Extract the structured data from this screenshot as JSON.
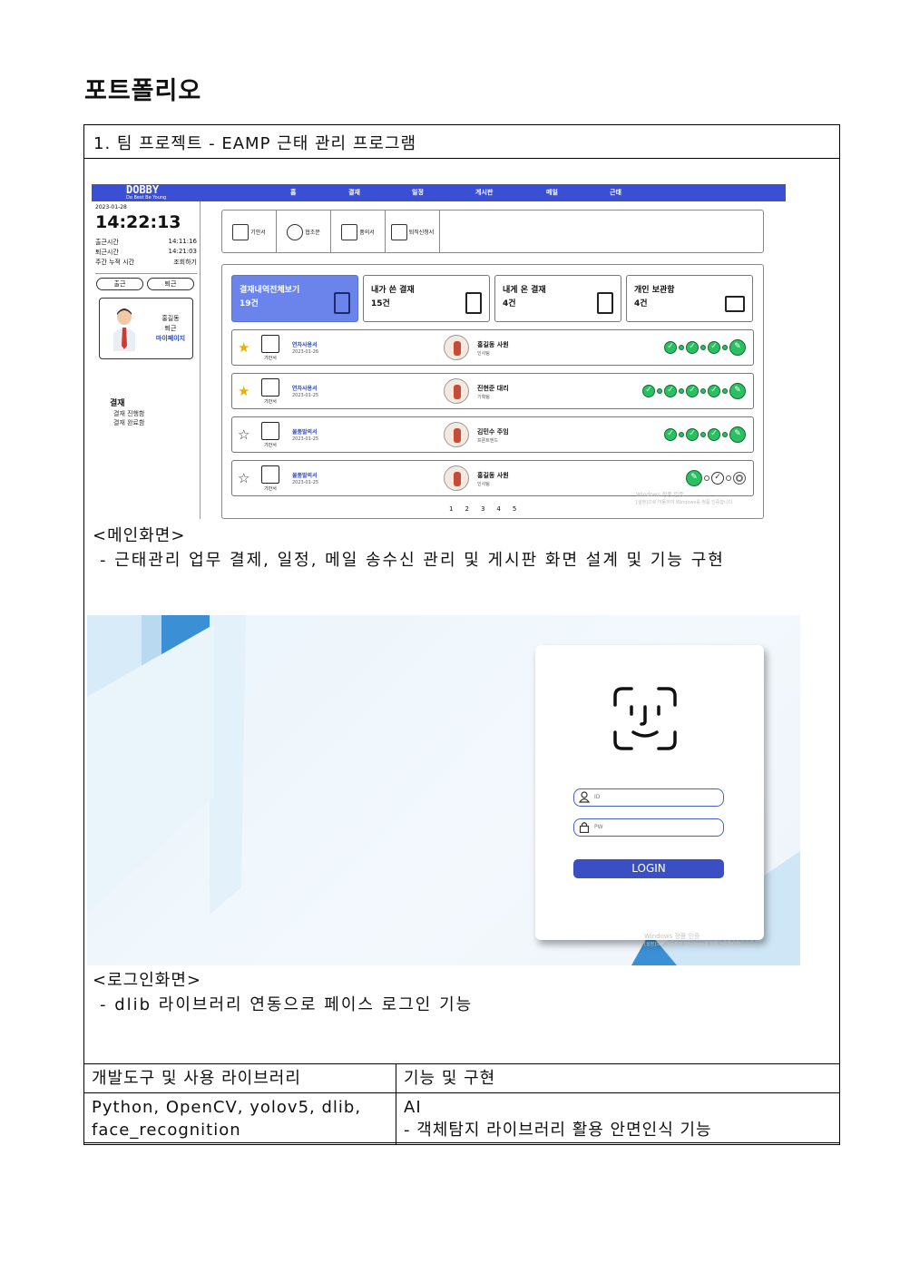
{
  "page_title": "포트폴리오",
  "section": {
    "heading": "1. 팀 프로젝트  - EAMP 근태 관리 프로그램"
  },
  "main_screen": {
    "logo": "DOBBY",
    "logo_sub": "Do Best Be Young",
    "nav": [
      "홈",
      "결재",
      "일정",
      "게시판",
      "메일",
      "근태"
    ],
    "date": "2023-01-28",
    "clock": "14:22:13",
    "times": [
      {
        "label": "출근시간",
        "value": "14:11:16"
      },
      {
        "label": "퇴근시간",
        "value": "14:21:03"
      },
      {
        "label": "주간 누적 시간",
        "value": "조회하기"
      }
    ],
    "btn_in": "출근",
    "btn_out": "퇴근",
    "profile": {
      "name": "홍길동",
      "status": "퇴근",
      "mypage": "마이페이지"
    },
    "menu": {
      "title": "결재",
      "items": [
        "결재 진행함",
        "결재 완료함"
      ]
    },
    "quick": [
      "기안서",
      "협조문",
      "품의서",
      "퇴직신청서"
    ],
    "tabs": [
      {
        "label": "결재내역전체보기",
        "count": "19건"
      },
      {
        "label": "내가 쓴 결재",
        "count": "15건"
      },
      {
        "label": "내게 온 결재",
        "count": "4건"
      },
      {
        "label": "개인 보관함",
        "count": "4건"
      }
    ],
    "docs": [
      {
        "star": "★",
        "icon_caption": "기안서",
        "title": "연차사용서",
        "date": "2023-01-26",
        "person": "홍길동 사원",
        "dept": "인사팀"
      },
      {
        "star": "★",
        "icon_caption": "기안서",
        "title": "연차사용서",
        "date": "2023-01-25",
        "person": "진현준 대리",
        "dept": "기획팀"
      },
      {
        "star": "☆",
        "icon_caption": "기안서",
        "title": "물품발의서",
        "date": "2023-01-25",
        "person": "김민수 주임",
        "dept": "프론트엔드"
      },
      {
        "star": "☆",
        "icon_caption": "기안서",
        "title": "물품발의서",
        "date": "2023-01-25",
        "person": "홍길동 사원",
        "dept": "인사팀"
      }
    ],
    "pages": [
      "1",
      "2",
      "3",
      "4",
      "5"
    ],
    "watermark_1": "Windows 정품 인증",
    "watermark_2": "[설정]으로 이동하여 Windows를 정품 인증합니다."
  },
  "caption_main": "<메인화면>",
  "desc_main": "- 근태관리 업무 결제, 일정, 메일 송수신 관리 및 게시판 화면 설계 및 기능 구현",
  "login_screen": {
    "id_placeholder": "ID",
    "pw_placeholder": "PW",
    "login_label": "LOGIN",
    "watermark_1": "Windows 정품 인증",
    "watermark_2": "[설정]으로 이동하여 Windows를 정품 인증합니다."
  },
  "caption_login": "<로그인화면>",
  "desc_login": "- dlib 라이브러리 연동으로 페이스 로그인 기능",
  "table": {
    "head": [
      "개발도구 및 사용 라이브러리",
      "기능 및 구현"
    ],
    "row_left": [
      "Python, OpenCV, yolov5, dlib,",
      "face_recognition"
    ],
    "row_right": [
      "AI",
      "- 객체탐지 라이브러리 활용 안면인식 기능"
    ]
  },
  "colors": {
    "topbar": "#3a4fd3",
    "active_tab": "#6a84ec",
    "check": "#28c060",
    "login_button": "#3a4fc4"
  }
}
